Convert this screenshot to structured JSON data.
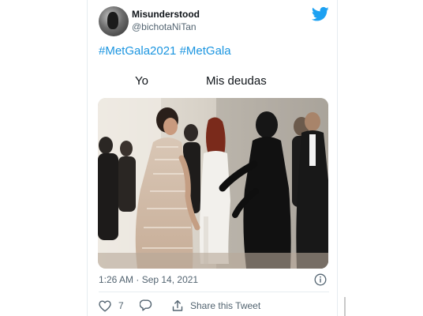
{
  "tweet": {
    "display_name": "Misunderstood",
    "handle": "@bichotaNiTan",
    "hashtags": "#MetGala2021 #MetGala",
    "meme": {
      "left_caption": "Yo",
      "right_caption": "Mis deudas"
    },
    "timestamp": "1:26 AM · Sep 14, 2021",
    "like_count": "7",
    "share_label": "Share this Tweet"
  },
  "icons": {
    "brand": "twitter-bird-icon",
    "info": "info-icon",
    "like": "heart-icon",
    "reply": "reply-icon",
    "share": "share-icon"
  },
  "colors": {
    "link": "#1b95e0",
    "brand": "#1da1f2",
    "secondary_text": "#536471",
    "divider": "#e6ecf0"
  }
}
